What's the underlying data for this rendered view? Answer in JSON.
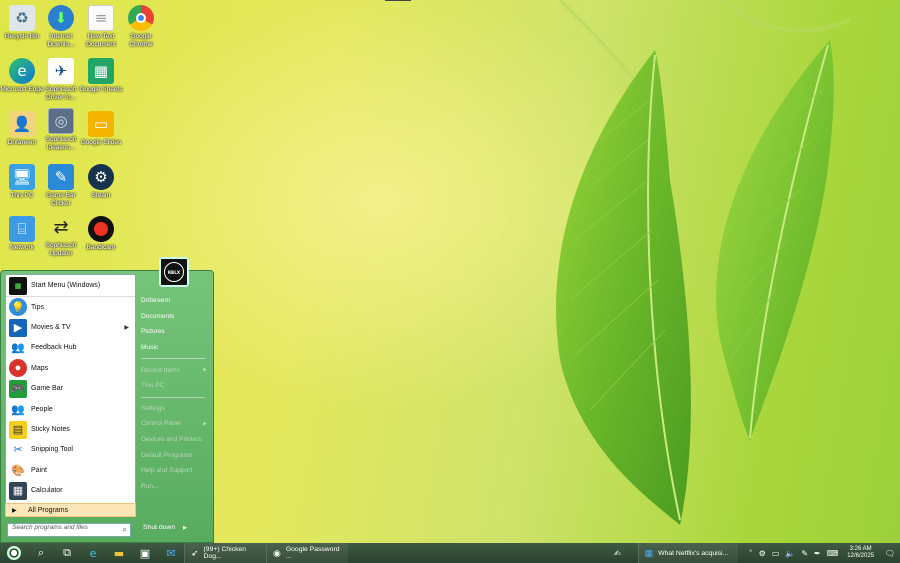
{
  "desktop": {
    "icons": [
      {
        "label": "Recycle Bin",
        "icon": "recycle-bin-icon"
      },
      {
        "label": "Internet Downlo...",
        "icon": "internet-download-manager-icon"
      },
      {
        "label": "New Text Document",
        "icon": "text-document-icon"
      },
      {
        "label": "Google Chrome",
        "icon": "chrome-icon"
      },
      {
        "label": "Microsoft Edge",
        "icon": "edge-icon"
      },
      {
        "label": "Sophiasoft Driver In...",
        "icon": "driver-installer-icon"
      },
      {
        "label": "Google Sheets",
        "icon": "sheets-icon"
      },
      {
        "label": "Drifareem",
        "icon": "user-folder-icon"
      },
      {
        "label": "Sophiasoft Ideation...",
        "icon": "ideation-app-icon"
      },
      {
        "label": "Google Slides",
        "icon": "slides-icon"
      },
      {
        "label": "This PC",
        "icon": "this-pc-icon"
      },
      {
        "label": "Game Bar Clicker",
        "icon": "game-bar-clicker-icon"
      },
      {
        "label": "Steam",
        "icon": "steam-icon"
      },
      {
        "label": "Network",
        "icon": "network-icon"
      },
      {
        "label": "Sophiasoft Updater",
        "icon": "updater-icon"
      },
      {
        "label": "Bandicam",
        "icon": "bandicam-icon"
      }
    ]
  },
  "start_menu": {
    "first_item": "Start Menu (Windows)",
    "items": [
      {
        "label": "Tips",
        "icon": "tips-icon"
      },
      {
        "label": "Movies & TV",
        "icon": "movies-icon",
        "has_submenu": true
      },
      {
        "label": "Feedback Hub",
        "icon": "feedback-icon"
      },
      {
        "label": "Maps",
        "icon": "maps-icon"
      },
      {
        "label": "Game Bar",
        "icon": "game-bar-icon"
      },
      {
        "label": "People",
        "icon": "people-icon"
      },
      {
        "label": "Sticky Notes",
        "icon": "sticky-notes-icon"
      },
      {
        "label": "Snipping Tool",
        "icon": "snipping-icon"
      },
      {
        "label": "Paint",
        "icon": "paint-icon"
      },
      {
        "label": "Calculator",
        "icon": "calculator-icon"
      }
    ],
    "all_programs": "All Programs",
    "search_placeholder": "Search programs and files",
    "avatar_text": "RBLX",
    "right_items": [
      {
        "label": "Drifareem",
        "dim": false
      },
      {
        "label": "Documents",
        "dim": false
      },
      {
        "label": "Pictures",
        "dim": false
      },
      {
        "label": "Music",
        "dim": false
      },
      {
        "sep": true
      },
      {
        "label": "Recent Items",
        "dim": true,
        "arrow": true
      },
      {
        "label": "This PC",
        "dim": true
      },
      {
        "sep": true
      },
      {
        "label": "Settings",
        "dim": true
      },
      {
        "label": "Control Panel",
        "dim": true,
        "arrow": true
      },
      {
        "label": "Devices and Printers",
        "dim": true
      },
      {
        "label": "Default Programs",
        "dim": true
      },
      {
        "label": "Help and Support",
        "dim": true
      },
      {
        "label": "Run...",
        "dim": true
      }
    ],
    "shutdown": "Shut down"
  },
  "taskbar": {
    "tasks": [
      {
        "label": "(99+) Chicken Dog...",
        "icon": "feather-icon"
      },
      {
        "label": "Google Password ...",
        "icon": "chrome-icon"
      }
    ],
    "news_task": "What Netflix's acquisi...",
    "clock_time": "3:26 AM",
    "clock_date": "12/6/2025"
  },
  "colors": {
    "start_menu_green": "#58ab5f",
    "taskbar": "#2c432f",
    "all_programs_highlight": "#fde6b8"
  }
}
